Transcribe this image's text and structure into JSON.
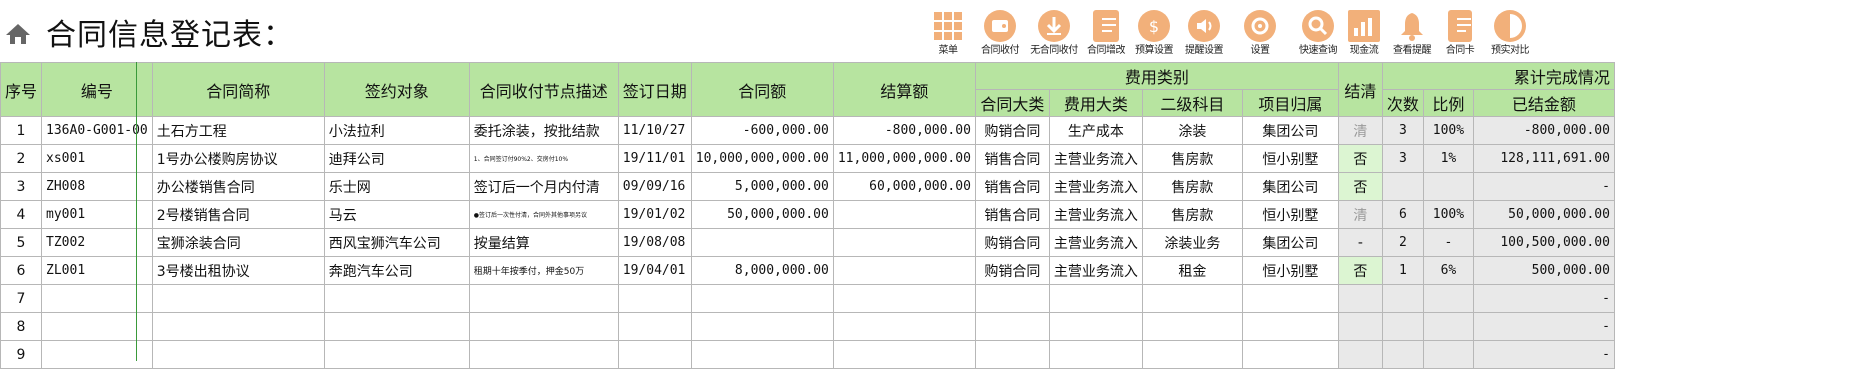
{
  "page": {
    "title": "合同信息登记表："
  },
  "toolbar": [
    {
      "label": "菜单",
      "icon": "menu-grid-icon"
    },
    {
      "label": "合同收付",
      "icon": "wallet-icon"
    },
    {
      "label": "无合同收付",
      "icon": "download-icon"
    },
    {
      "label": "合同增改",
      "icon": "document-icon"
    },
    {
      "label": "预算设置",
      "icon": "money-bag-icon"
    },
    {
      "label": "提醒设置",
      "icon": "speaker-icon"
    },
    {
      "label": "设置",
      "icon": "gear-icon"
    },
    {
      "label": "快速查询",
      "icon": "search-icon"
    },
    {
      "label": "现金流",
      "icon": "bar-chart-icon"
    },
    {
      "label": "查看提醒",
      "icon": "bell-icon"
    },
    {
      "label": "合同卡",
      "icon": "card-icon"
    },
    {
      "label": "预实对比",
      "icon": "pie-half-icon"
    }
  ],
  "table": {
    "headers": {
      "seq": "序号",
      "code": "编号",
      "name": "合同简称",
      "party": "签约对象",
      "node": "合同收付节点描述",
      "date": "签订日期",
      "amount": "合同额",
      "settle": "结算额",
      "expense_group": "费用类别",
      "big_class": "合同大类",
      "cost_class": "费用大类",
      "sub_subject": "二级科目",
      "project": "项目归属",
      "cleared": "结清",
      "progress_group": "累计完成情况",
      "times": "次数",
      "ratio": "比例",
      "settled_amt": "已结金额"
    },
    "rows": [
      {
        "seq": "1",
        "code": "136A0-G001-00",
        "name": "土石方工程",
        "party": "小法拉利",
        "node": "委托涂装，按批结款",
        "date": "11/10/27",
        "amount": "-600,000.00",
        "settle": "-800,000.00",
        "big_class": "购销合同",
        "cost_class": "生产成本",
        "sub_subject": "涂装",
        "project": "集团公司",
        "cleared": "清",
        "times": "3",
        "ratio": "100%",
        "settled_amt": "-800,000.00"
      },
      {
        "seq": "2",
        "code": "xs001",
        "name": "1号办公楼购房协议",
        "party": "迪拜公司",
        "node": "1、合同签订付90%2、交房付10%",
        "date": "19/11/01",
        "amount": "10,000,000,000.00",
        "settle": "11,000,000,000.00",
        "big_class": "销售合同",
        "cost_class": "主营业务流入",
        "sub_subject": "售房款",
        "project": "恒小别墅",
        "cleared": "否",
        "times": "3",
        "ratio": "1%",
        "settled_amt": "128,111,691.00"
      },
      {
        "seq": "3",
        "code": "ZH008",
        "name": "办公楼销售合同",
        "party": "乐士网",
        "node": "签订后一个月内付清",
        "date": "09/09/16",
        "amount": "5,000,000.00",
        "settle": "60,000,000.00",
        "big_class": "销售合同",
        "cost_class": "主营业务流入",
        "sub_subject": "售房款",
        "project": "集团公司",
        "cleared": "否",
        "times": "",
        "ratio": "",
        "settled_amt": "-"
      },
      {
        "seq": "4",
        "code": "my001",
        "name": "2号楼销售合同",
        "party": "马云",
        "node": "●签订后一次性付清，合同外其他事项另议",
        "date": "19/01/02",
        "amount": "50,000,000.00",
        "settle": "",
        "big_class": "销售合同",
        "cost_class": "主营业务流入",
        "sub_subject": "售房款",
        "project": "恒小别墅",
        "cleared": "清",
        "times": "6",
        "ratio": "100%",
        "settled_amt": "50,000,000.00"
      },
      {
        "seq": "5",
        "code": "TZ002",
        "name": "宝狮涂装合同",
        "party": "西风宝狮汽车公司",
        "node": "按量结算",
        "date": "19/08/08",
        "amount": "",
        "settle": "",
        "big_class": "购销合同",
        "cost_class": "主营业务流入",
        "sub_subject": "涂装业务",
        "project": "集团公司",
        "cleared": "-",
        "times": "2",
        "ratio": "-",
        "settled_amt": "100,500,000.00"
      },
      {
        "seq": "6",
        "code": "ZL001",
        "name": "3号楼出租协议",
        "party": "奔跑汽车公司",
        "node": "租期十年按季付，押金50万",
        "date": "19/04/01",
        "amount": "8,000,000.00",
        "settle": "",
        "big_class": "购销合同",
        "cost_class": "主营业务流入",
        "sub_subject": "租金",
        "project": "恒小别墅",
        "cleared": "否",
        "times": "1",
        "ratio": "6%",
        "settled_amt": "500,000.00"
      },
      {
        "seq": "7",
        "code": "",
        "name": "",
        "party": "",
        "node": "",
        "date": "",
        "amount": "",
        "settle": "",
        "big_class": "",
        "cost_class": "",
        "sub_subject": "",
        "project": "",
        "cleared": "",
        "times": "",
        "ratio": "",
        "settled_amt": "-"
      },
      {
        "seq": "8",
        "code": "",
        "name": "",
        "party": "",
        "node": "",
        "date": "",
        "amount": "",
        "settle": "",
        "big_class": "",
        "cost_class": "",
        "sub_subject": "",
        "project": "",
        "cleared": "",
        "times": "",
        "ratio": "",
        "settled_amt": "-"
      },
      {
        "seq": "9",
        "code": "",
        "name": "",
        "party": "",
        "node": "",
        "date": "",
        "amount": "",
        "settle": "",
        "big_class": "",
        "cost_class": "",
        "sub_subject": "",
        "project": "",
        "cleared": "",
        "times": "",
        "ratio": "",
        "settled_amt": "-"
      }
    ]
  },
  "colors": {
    "header_green": "#b7e4a0",
    "icon_orange": "#f2b07a",
    "cleared_green": "#dcf5d2",
    "gridline": "#b7b7b7"
  }
}
